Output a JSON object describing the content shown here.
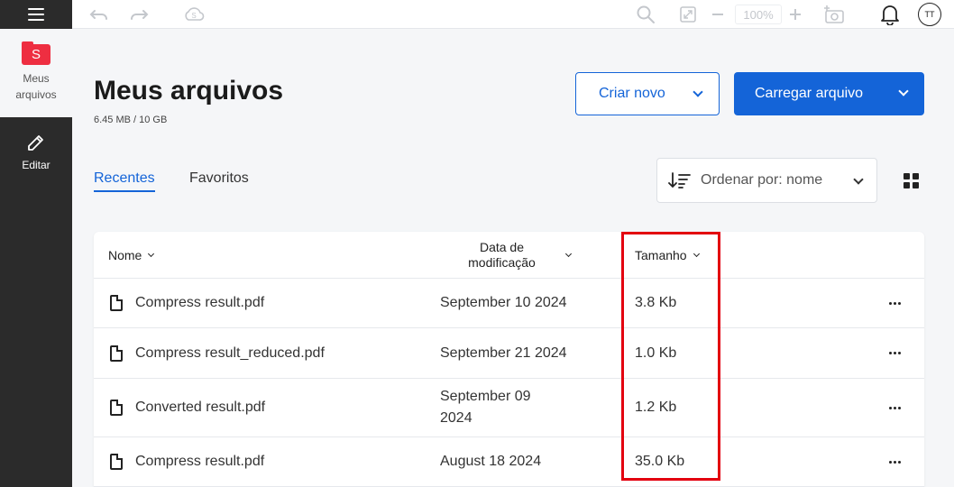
{
  "sidebar": {
    "menu_icon": "hamburger-icon",
    "files": {
      "icon": "folder-icon",
      "badge": "S",
      "label": "Meus arquivos"
    },
    "edit": {
      "icon": "pencil-icon",
      "label": "Editar"
    }
  },
  "toolbar": {
    "undo_icon": "undo-icon",
    "redo_icon": "redo-icon",
    "cloud_icon": "cloud-sync-icon",
    "cloud_badge": "S",
    "search_icon": "search-icon",
    "fit_icon": "fit-screen-icon",
    "zoom_out_icon": "minus-icon",
    "zoom_level": "100%",
    "zoom_in_icon": "plus-icon",
    "screenshot_icon": "camera-add-icon",
    "bell_icon": "bell-icon",
    "avatar_initials": "TT"
  },
  "header": {
    "title": "Meus arquivos",
    "storage": "6.45 MB / 10 GB",
    "create_label": "Criar novo",
    "upload_label": "Carregar arquivo"
  },
  "tabs": [
    {
      "label": "Recentes",
      "active": true
    },
    {
      "label": "Favoritos",
      "active": false
    }
  ],
  "sort": {
    "icon": "sort-icon",
    "label": "Ordenar por: nome"
  },
  "view_icon": "grid-view-icon",
  "table": {
    "columns": {
      "name": "Nome",
      "date": "Data de modificação",
      "size": "Tamanho"
    },
    "rows": [
      {
        "name": "Compress result.pdf",
        "date": "September 10 2024",
        "size": "3.8 Kb"
      },
      {
        "name": "Compress result_reduced.pdf",
        "date": "September 21 2024",
        "size": "1.0 Kb"
      },
      {
        "name": "Converted result.pdf",
        "date": "September 09 2024",
        "size": "1.2 Kb"
      },
      {
        "name": "Compress result.pdf",
        "date": "August 18 2024",
        "size": "35.0 Kb"
      }
    ]
  },
  "colors": {
    "accent": "#1464d8",
    "brand_red": "#ee2e41",
    "highlight": "#e3000f",
    "sidebar_bg": "#2b2b2b"
  }
}
